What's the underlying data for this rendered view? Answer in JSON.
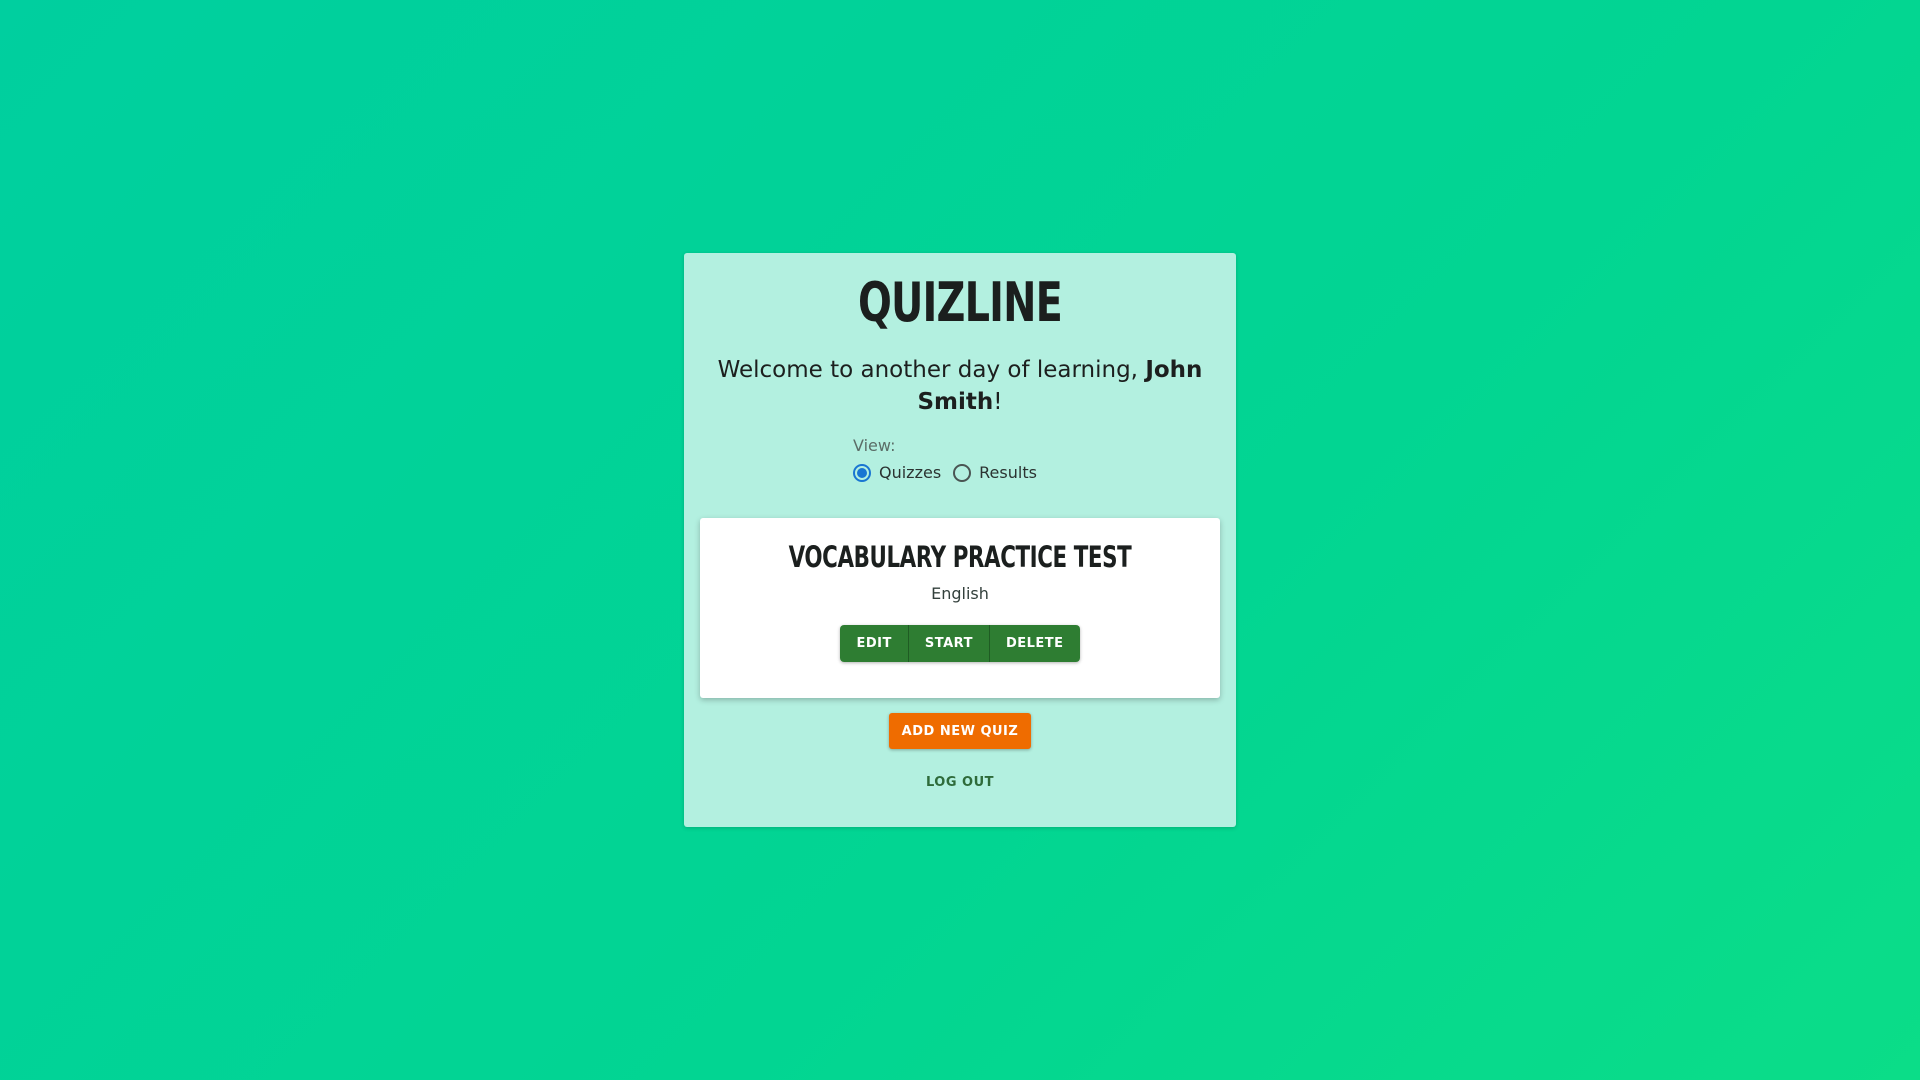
{
  "app": {
    "title": "QUIZLINE"
  },
  "welcome": {
    "prefix": "Welcome to another day of learning, ",
    "user_name": "John Smith",
    "suffix": "!"
  },
  "view": {
    "label": "View:",
    "options": [
      {
        "label": "Quizzes",
        "selected": true
      },
      {
        "label": "Results",
        "selected": false
      }
    ]
  },
  "quiz_card": {
    "title": "VOCABULARY PRACTICE TEST",
    "subject": "English",
    "edit_label": "EDIT",
    "start_label": "START",
    "delete_label": "DELETE"
  },
  "actions": {
    "add_quiz_label": "ADD NEW QUIZ",
    "logout_label": "LOG OUT"
  },
  "colors": {
    "background": "#02d592",
    "panel": "#b3f0e0",
    "primary_button": "#2e7d32",
    "accent_button": "#ef6c00",
    "radio_selected": "#1976d2"
  }
}
